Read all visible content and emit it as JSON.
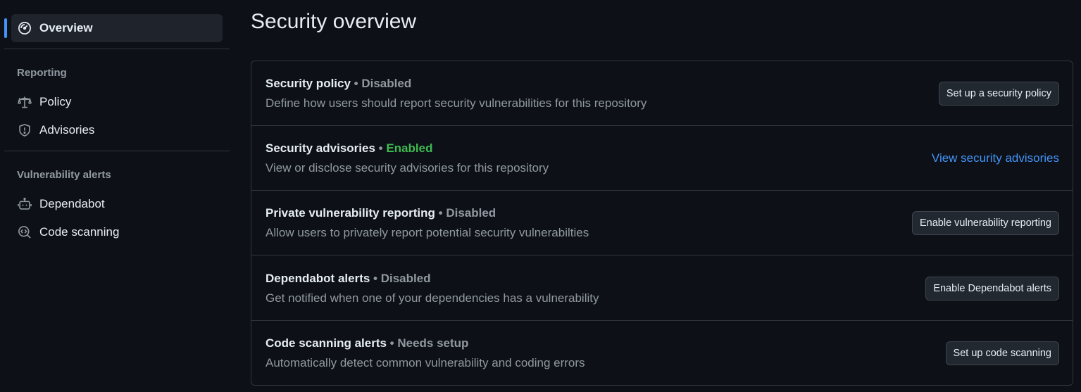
{
  "sidebar": {
    "overview": {
      "label": "Overview",
      "icon": "meter-icon"
    },
    "reporting": {
      "heading": "Reporting",
      "items": [
        {
          "label": "Policy",
          "icon": "law-icon"
        },
        {
          "label": "Advisories",
          "icon": "shield-icon"
        }
      ]
    },
    "vulnerability_alerts": {
      "heading": "Vulnerability alerts",
      "items": [
        {
          "label": "Dependabot",
          "icon": "dependabot-icon"
        },
        {
          "label": "Code scanning",
          "icon": "codescan-icon"
        }
      ]
    }
  },
  "main": {
    "title": "Security overview",
    "rows": [
      {
        "title": "Security policy",
        "separator": " • ",
        "status": "Disabled",
        "description": "Define how users should report security vulnerabilities for this repository",
        "action": "Set up a security policy"
      },
      {
        "title": "Security advisories",
        "separator": " • ",
        "status": "Enabled",
        "description": "View or disclose security advisories for this repository",
        "action": "View security advisories"
      },
      {
        "title": "Private vulnerability reporting",
        "separator": " • ",
        "status": "Disabled",
        "description": "Allow users to privately report potential security vulnerabilties",
        "action": "Enable vulnerability reporting"
      },
      {
        "title": "Dependabot alerts",
        "separator": " • ",
        "status": "Disabled",
        "description": "Get notified when one of your dependencies has a vulnerability",
        "action": "Enable Dependabot alerts"
      },
      {
        "title": "Code scanning alerts",
        "separator": " • ",
        "status": "Needs setup",
        "description": "Automatically detect common vulnerability and coding errors",
        "action": "Set up code scanning"
      }
    ]
  },
  "colors": {
    "background": "#0d1117",
    "accent": "#4493f8",
    "enabled": "#3fb950",
    "muted": "#9198a1"
  }
}
